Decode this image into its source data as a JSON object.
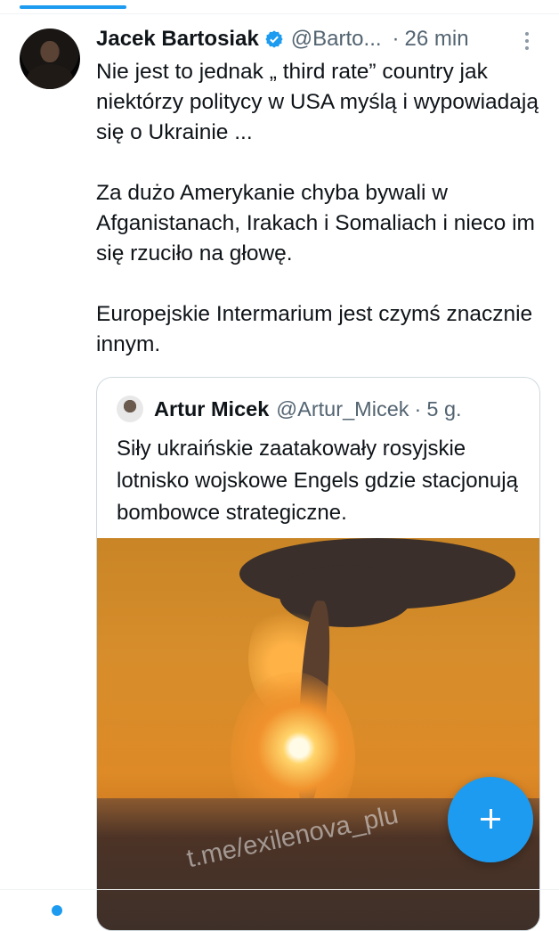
{
  "tweet": {
    "author_name": "Jacek Bartosiak",
    "author_handle": "@Barto...",
    "separator": "·",
    "time": "26 min",
    "paragraphs": [
      "Nie jest to jednak „ third rate” country jak niektórzy politycy w USA myślą i wypowiadają się o Ukrainie ...",
      "Za dużo Amerykanie chyba bywali w Afganistanach, Irakach i Somaliach i nieco im się rzuciło na głowę.",
      "Europejskie Intermarium jest czymś znacznie innym."
    ]
  },
  "quote": {
    "author_name": "Artur Micek",
    "author_handle": "@Artur_Micek",
    "separator": "·",
    "time": "5 g.",
    "text": "Siły ukraińskie zaatakowały rosyjskie lotnisko wojskowe Engels gdzie stacjonują bombowce strategiczne.",
    "media_watermark": "t.me/exilenova_plu"
  },
  "fab": {
    "label": "+"
  },
  "colors": {
    "accent": "#1d9bf0",
    "secondary_text": "#536471",
    "primary_text": "#0f1419",
    "border": "#cfd9de"
  },
  "icons": [
    "verified-badge-icon",
    "more-options-icon",
    "compose-plus-icon"
  ]
}
